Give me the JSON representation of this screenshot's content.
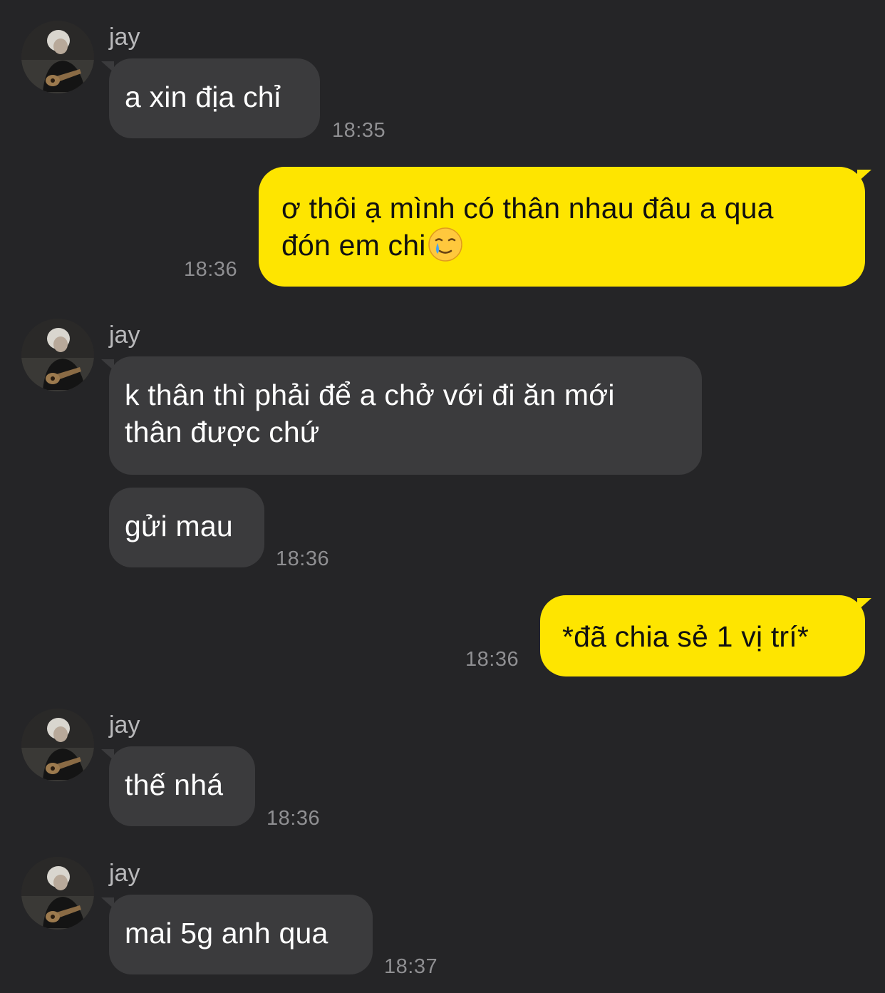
{
  "messages": [
    {
      "sender": "jay",
      "text": "a xin địa chỉ",
      "time": "18:35"
    },
    {
      "line1": "ơ thôi ạ mình có thân nhau đâu a qua",
      "line2": "đón em chi",
      "emoji": "crying-smile-emoji",
      "time": "18:36"
    },
    {
      "sender": "jay",
      "line1": "k thân thì phải để a chở với đi ăn mới",
      "line2": "thân được chứ"
    },
    {
      "text": "gửi mau",
      "time": "18:36"
    },
    {
      "text": "*đã chia sẻ 1 vị trí*",
      "time": "18:36"
    },
    {
      "sender": "jay",
      "text": "thế nhá",
      "time": "18:36"
    },
    {
      "sender": "jay",
      "text": "mai 5g anh qua",
      "time": "18:37"
    }
  ],
  "colors": {
    "background": "#252527",
    "incoming_bubble": "#3b3b3d",
    "outgoing_bubble": "#fee500",
    "timestamp": "#8f8f92"
  }
}
